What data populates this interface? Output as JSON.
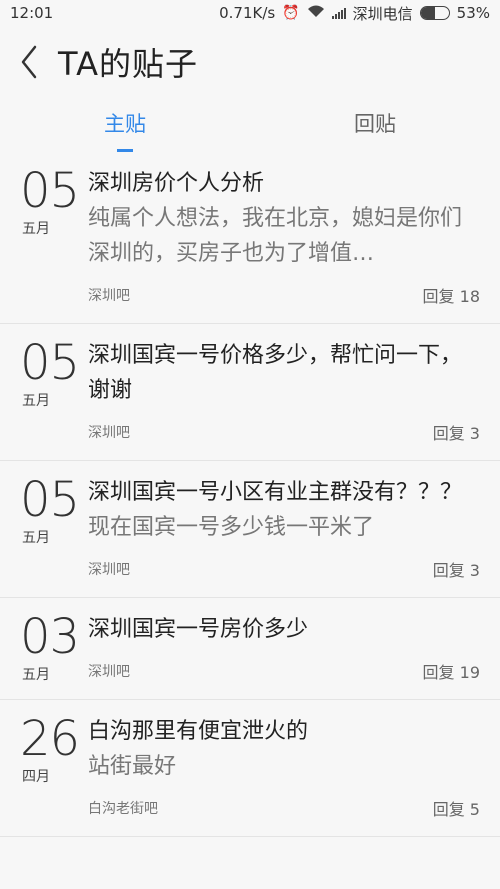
{
  "status_bar": {
    "time": "12:01",
    "speed": "0.71K/s",
    "carrier": "深圳电信",
    "battery_text": "53%",
    "battery_level": 0.53,
    "icons": [
      "alarm-icon",
      "wifi-icon",
      "signal-icon",
      "battery-icon"
    ]
  },
  "header": {
    "title": "TA的贴子",
    "back_icon": "chevron-left-icon"
  },
  "tabs": [
    {
      "label": "主贴",
      "active": true
    },
    {
      "label": "回贴",
      "active": false
    }
  ],
  "colors": {
    "accent": "#3388e8",
    "background": "#f7f7f7",
    "divider": "#e4e4e4"
  },
  "posts": [
    {
      "day": "05",
      "month": "五月",
      "title": "深圳房价个人分析",
      "excerpt": "纯属个人想法，我在北京，媳妇是你们深圳的，买房子也为了增值…",
      "forum": "深圳吧",
      "reply": "回复 18"
    },
    {
      "day": "05",
      "month": "五月",
      "title": "深圳国宾一号价格多少，帮忙问一下，谢谢",
      "excerpt": "",
      "forum": "深圳吧",
      "reply": "回复 3"
    },
    {
      "day": "05",
      "month": "五月",
      "title": "深圳国宾一号小区有业主群没有？？？",
      "excerpt": "现在国宾一号多少钱一平米了",
      "forum": "深圳吧",
      "reply": "回复 3"
    },
    {
      "day": "03",
      "month": "五月",
      "title": "深圳国宾一号房价多少",
      "excerpt": "",
      "forum": "深圳吧",
      "reply": "回复 19"
    },
    {
      "day": "26",
      "month": "四月",
      "title": "白沟那里有便宜泄火的",
      "excerpt": "站街最好",
      "forum": "白沟老街吧",
      "reply": "回复 5"
    }
  ]
}
